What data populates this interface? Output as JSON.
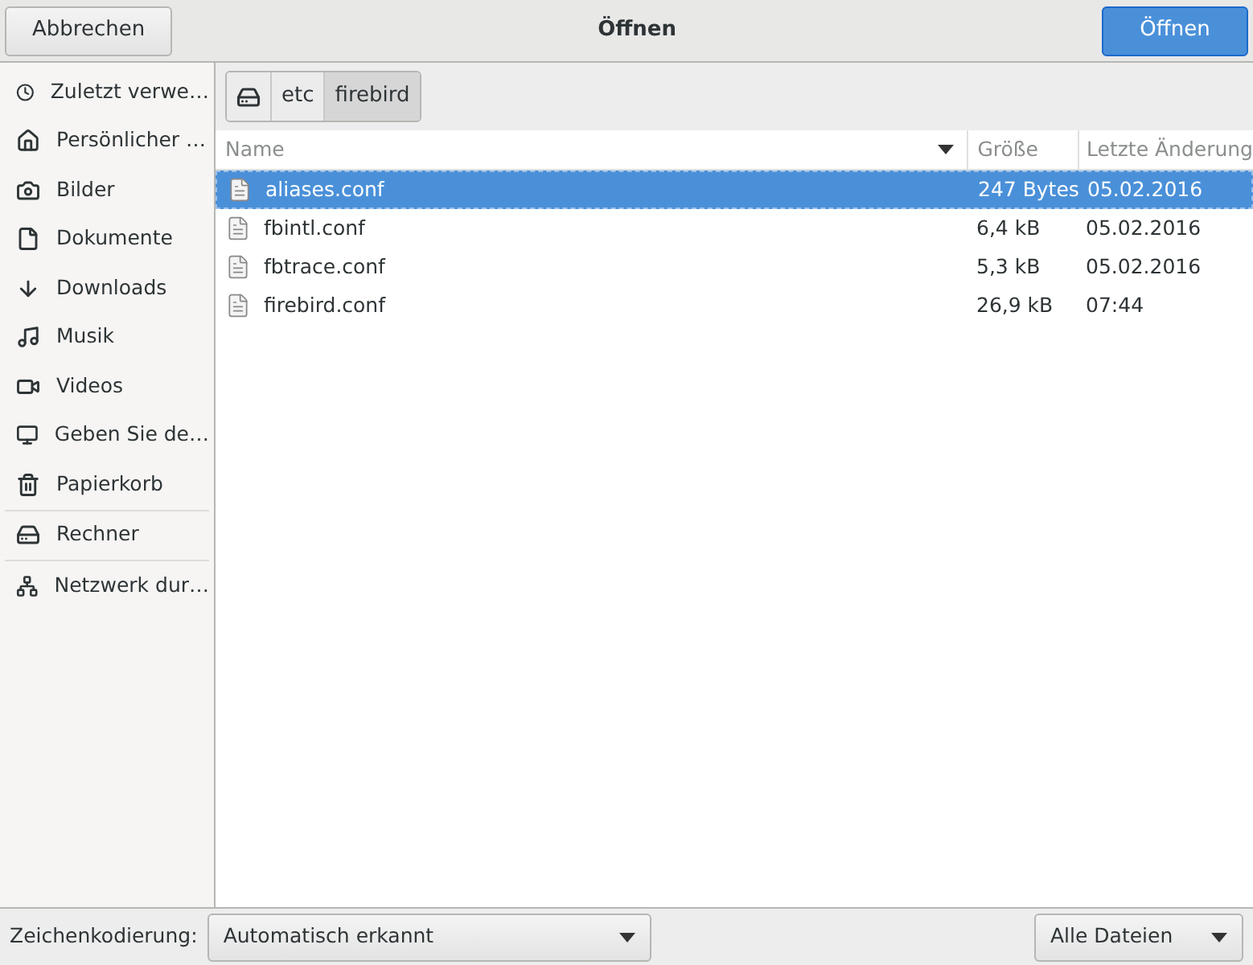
{
  "header": {
    "cancel_button": "Abbrechen",
    "title": "Öffnen",
    "open_button": "Öffnen"
  },
  "sidebar": {
    "sections": [
      [
        {
          "kind": "recent",
          "label": "Zuletzt verwe…"
        },
        {
          "kind": "home",
          "label": "Persönlicher …"
        },
        {
          "kind": "pictures",
          "label": "Bilder"
        },
        {
          "kind": "documents",
          "label": "Dokumente"
        },
        {
          "kind": "downloads",
          "label": "Downloads"
        },
        {
          "kind": "music",
          "label": "Musik"
        },
        {
          "kind": "videos",
          "label": "Videos"
        },
        {
          "kind": "device",
          "label": "Geben Sie de…"
        },
        {
          "kind": "trash",
          "label": "Papierkorb"
        }
      ],
      [
        {
          "kind": "computer",
          "label": "Rechner"
        }
      ],
      [
        {
          "kind": "network",
          "label": "Netzwerk dur…"
        }
      ]
    ]
  },
  "path_bar": [
    {
      "kind": "drive",
      "selected": false
    },
    {
      "kind": "folder",
      "label": "etc",
      "selected": false
    },
    {
      "kind": "folder",
      "label": "firebird",
      "selected": true
    }
  ],
  "table": {
    "columns": [
      "Name",
      "Größe",
      "Letzte Änderung"
    ],
    "rows": [
      {
        "name": "aliases.conf",
        "size": "247 Bytes",
        "modified": "05.02.2016",
        "selected": true
      },
      {
        "name": "fbintl.conf",
        "size": "6,4 kB",
        "modified": "05.02.2016",
        "selected": false
      },
      {
        "name": "fbtrace.conf",
        "size": "5,3 kB",
        "modified": "05.02.2016",
        "selected": false
      },
      {
        "name": "firebird.conf",
        "size": "26,9 kB",
        "modified": "07:44",
        "selected": false
      }
    ]
  },
  "footer": {
    "encoding_label": "Zeichenkodierung:",
    "encoding_value": "Automatisch erkannt",
    "filter_value": "Alle Dateien"
  }
}
